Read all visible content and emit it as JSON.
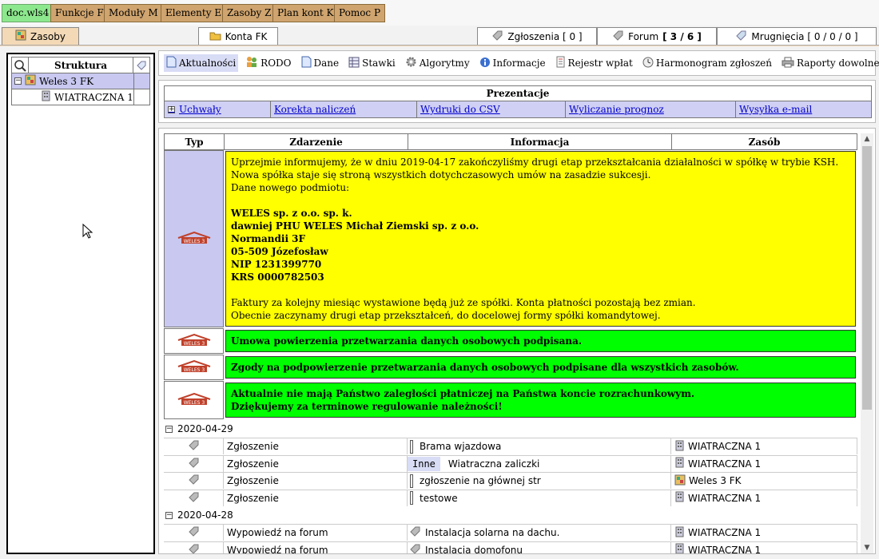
{
  "menubar": {
    "items": [
      "doc.wls4",
      "Funkcje F",
      "Moduły M",
      "Elementy E",
      "Zasoby Z",
      "Plan kont K",
      "Pomoc P"
    ]
  },
  "tabs": {
    "zasoby": "Zasoby",
    "konta": "Konta FK",
    "zgloszenia": "Zgłoszenia [ 0 ]",
    "forum_label": "Forum",
    "forum_count": "[ 3 / 6 ]",
    "mrugniecia": "Mrugnięcia [ 0 / 0 / 0 ]"
  },
  "tree": {
    "header": "Struktura",
    "root": "Weles 3 FK",
    "child": "WIATRACZNA 1"
  },
  "subnav": [
    "Aktualności",
    "RODO",
    "Dane",
    "Stawki",
    "Algorytmy",
    "Informacje",
    "Rejestr wpłat",
    "Harmonogram zgłoszeń",
    "Raporty dowolne"
  ],
  "prezentacje": {
    "title": "Prezentacje",
    "links": [
      "Uchwały",
      "Korekta naliczeń",
      "Wydruki do CSV",
      "Wyliczanie prognoz",
      "Wysyłka e-mail"
    ]
  },
  "table": {
    "headers": [
      "Typ",
      "Zdarzenie",
      "Informacja",
      "Zasób"
    ]
  },
  "announcement": {
    "line1": "Uprzejmie informujemy, że w dniu 2019-04-17 zakończyliśmy drugi etap przekształcania działalności w spółkę w trybie KSH.",
    "line2": "Nowa spółka staje się stroną wszystkich dotychczasowych umów na zasadzie sukcesji.",
    "line3": "Dane nowego podmiotu:",
    "company": "WELES sp. z o.o. sp. k.",
    "former": "dawniej PHU WELES Michał Ziemski sp. z o.o.",
    "street": "Normandii 3F",
    "city": "05-509 Józefosław",
    "nip": "NIP 1231399770",
    "krs": "KRS 0000782503",
    "line4": "Faktury za kolejny miesiąc wystawione będą już ze spółki. Konta płatności pozostają bez zmian.",
    "line5": "Obecnie zaczynamy drugi etap przekształceń, do docelowej formy spółki komandytowej."
  },
  "notices": [
    "Umowa powierzenia przetwarzania danych osobowych podpisana.",
    "Zgody na podpowierzenie przetwarzania danych osobowych podpisane dla wszystkich zasobów.",
    "Aktualnie nie mają Państwo zaległości płatniczej na Państwa koncie rozrachunkowym.",
    "Dziękujemy za terminowe regulowanie należności!"
  ],
  "logo_text": "WELES 3",
  "groups": [
    {
      "date": "2020-04-29",
      "rows": [
        {
          "event": "Zgłoszenie",
          "badge": "",
          "info": "Brama wjazdowa",
          "resource": "WIATRACZNA 1"
        },
        {
          "event": "Zgłoszenie",
          "badge": "Inne",
          "info": "Wiatraczna zaliczki",
          "resource": "WIATRACZNA 1"
        },
        {
          "event": "Zgłoszenie",
          "badge": "",
          "info": "zgłoszenie na głównej str",
          "resource": "Weles 3 FK"
        },
        {
          "event": "Zgłoszenie",
          "badge": "",
          "info": "testowe",
          "resource": "WIATRACZNA 1"
        }
      ]
    },
    {
      "date": "2020-04-28",
      "rows": [
        {
          "event": "Wypowiedź na forum",
          "badge": "",
          "info": "Instalacja solarna na dachu.",
          "resource": "WIATRACZNA 1"
        },
        {
          "event": "Wypowiedź na forum",
          "badge": "",
          "info": "Instalacja domofonu",
          "resource": "WIATRACZNA 1"
        }
      ]
    }
  ],
  "colors": {
    "menu_bg": "#cfa46e",
    "menu_first_bg": "#8de88d",
    "selection": "#c8c8f0",
    "yellow": "#ffff00",
    "green": "#00ff00"
  }
}
